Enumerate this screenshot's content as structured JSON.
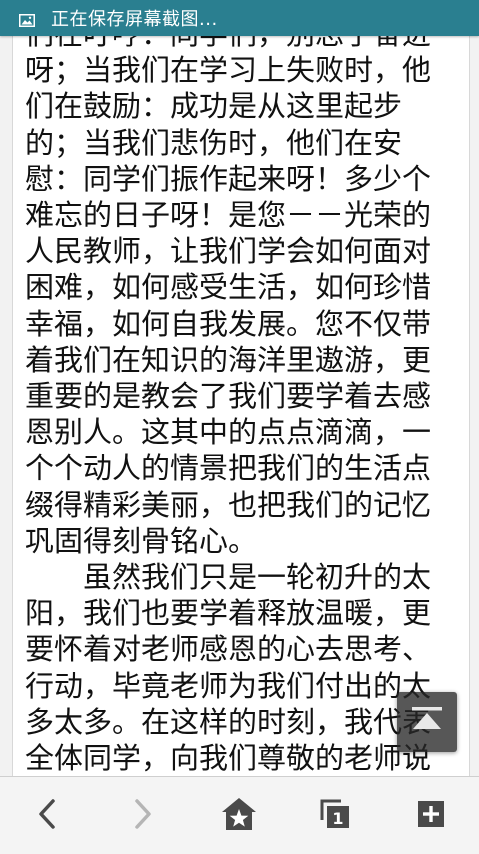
{
  "status_bar": {
    "icon": "image-icon",
    "text": "正在保存屏幕截图..."
  },
  "article": {
    "paragraph_1": "们在叮哼：同学们，别忘了奋进呀；当我们在学习上失败时，他们在鼓励：成功是从这里起步的；当我们悲伤时，他们在安慰：同学们振作起来呀！多少个难忘的日子呀！是您－－光荣的人民教师，让我们学会如何面对困难，如何感受生活，如何珍惜幸福，如何自我发展。您不仅带着我们在知识的海洋里遨游，更重要的是教会了我们要学着去感恩别人。这其中的点点滴滴，一个个动人的情景把我们的生活点缀得精彩美丽，也把我们的记忆巩固得刻骨铭心。",
    "paragraph_2": "虽然我们只是一轮初升的太阳，我们也要学着释放温暖，更要怀着对老师感恩的心去思考、行动，毕竟老师为我们付出的太多太多。在这样的时刻，我代表全体同学，向我们尊敬的老师说"
  },
  "floating": {
    "back_to_top_icon": "arrow-up-to-top-icon"
  },
  "toolbar": {
    "back_icon": "chevron-left-icon",
    "forward_icon": "chevron-right-icon",
    "home_icon": "home-star-icon",
    "tabs_icon": "tabs-icon",
    "new_tab_icon": "plus-icon",
    "tab_count": "1",
    "forward_enabled": false
  },
  "colors": {
    "status_bar": "#2a7f90",
    "toolbar_icon": "#4a4a4a",
    "toolbar_icon_disabled": "#b5b5b5",
    "text": "#111111"
  }
}
